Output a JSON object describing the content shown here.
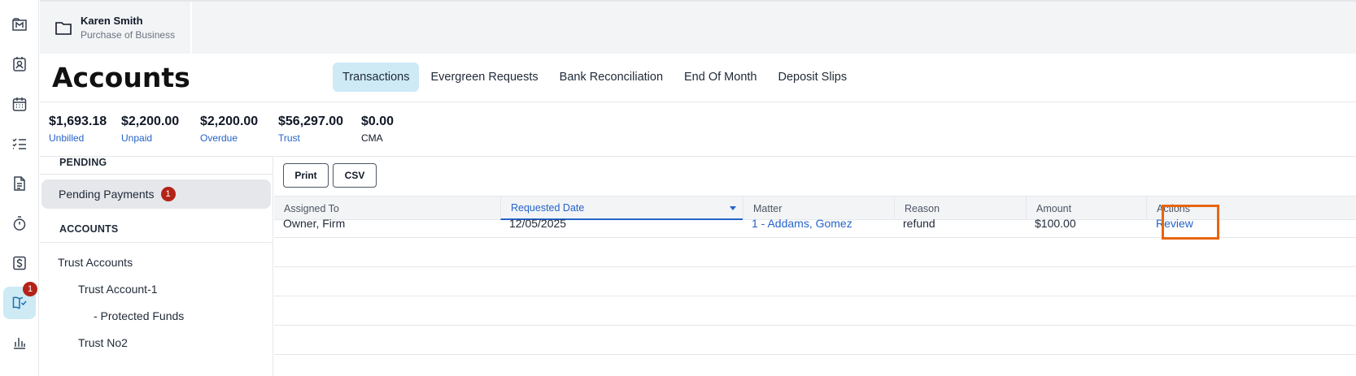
{
  "rail": {
    "items": [
      {
        "icon": "matters-icon"
      },
      {
        "icon": "contacts-icon"
      },
      {
        "icon": "calendar-icon"
      },
      {
        "icon": "tasks-icon"
      },
      {
        "icon": "documents-icon"
      },
      {
        "icon": "timer-icon"
      },
      {
        "icon": "billing-icon"
      },
      {
        "icon": "accounts-icon",
        "badge": "1"
      },
      {
        "icon": "reports-icon"
      }
    ]
  },
  "context": {
    "name": "Karen Smith",
    "subtitle": "Purchase of Business"
  },
  "header": {
    "title": "Accounts",
    "tabs": [
      {
        "label": "Transactions",
        "active": true
      },
      {
        "label": "Evergreen Requests"
      },
      {
        "label": "Bank Reconciliation"
      },
      {
        "label": "End Of Month"
      },
      {
        "label": "Deposit Slips"
      }
    ]
  },
  "stats": [
    {
      "value": "$1,693.18",
      "label": "Unbilled"
    },
    {
      "value": "$2,200.00",
      "label": "Unpaid"
    },
    {
      "value": "$2,200.00",
      "label": "Overdue"
    },
    {
      "value": "$56,297.00",
      "label": "Trust"
    },
    {
      "value": "$0.00",
      "label": "CMA"
    }
  ],
  "sidebar": {
    "pending_heading": "PENDING",
    "pending_item": {
      "label": "Pending Payments",
      "count": "1"
    },
    "accounts_heading": "ACCOUNTS",
    "tree": [
      {
        "label": "Trust Accounts"
      },
      {
        "label": "Trust Account-1"
      },
      {
        "label": "- Protected Funds"
      },
      {
        "label": "Trust No2"
      }
    ]
  },
  "toolbar": {
    "print_label": "Print",
    "csv_label": "CSV"
  },
  "table": {
    "columns": [
      "Assigned To",
      "Requested Date",
      "Matter",
      "Reason",
      "Amount",
      "Actions"
    ],
    "sorted_column": "Requested Date",
    "rows": [
      {
        "assigned_to": "Owner, Firm",
        "requested_date": "12/05/2025",
        "matter": "1 - Addams, Gomez",
        "reason": "refund",
        "amount": "$100.00",
        "action": "Review"
      }
    ]
  },
  "colors": {
    "accent": "#2563c9",
    "active_tab_bg": "#cdeaf5",
    "badge": "#b42318",
    "highlight": "#e8650f"
  }
}
